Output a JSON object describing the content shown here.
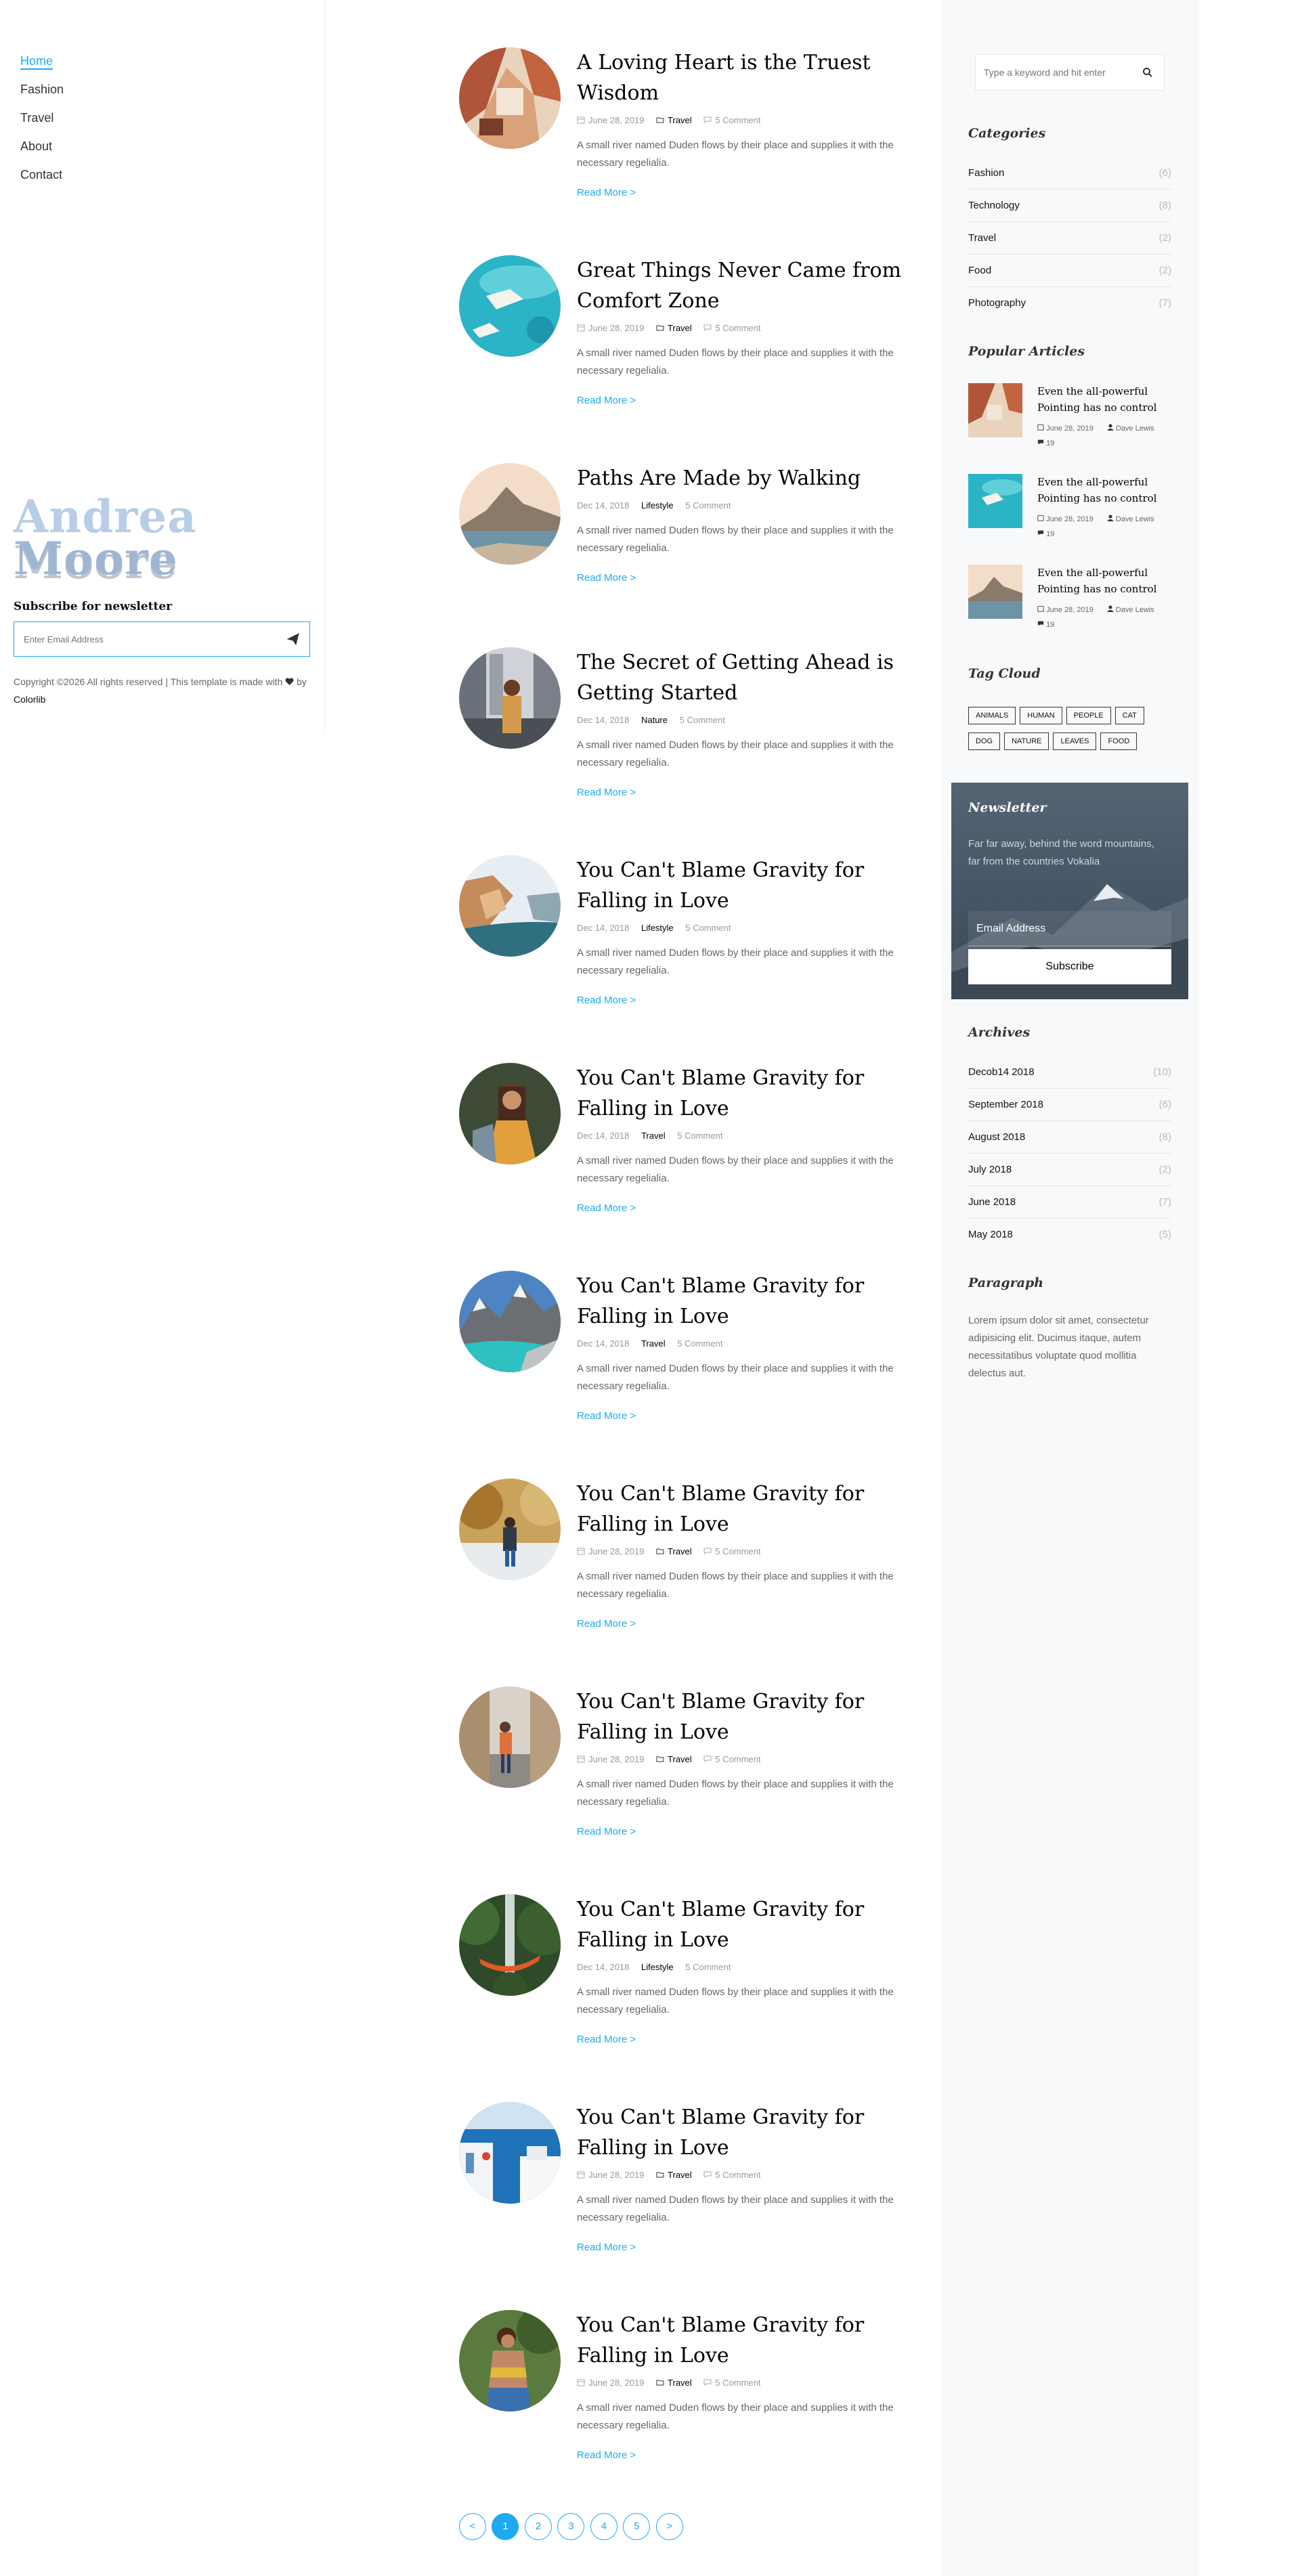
{
  "nav": {
    "items": [
      {
        "label": "Home",
        "active": true
      },
      {
        "label": "Fashion"
      },
      {
        "label": "Travel"
      },
      {
        "label": "About"
      },
      {
        "label": "Contact"
      }
    ]
  },
  "brand": {
    "line1": "Andrea",
    "line2": "Moore"
  },
  "left_newsletter": {
    "title": "Subscribe for newsletter",
    "placeholder": "Enter Email Address"
  },
  "copyright": {
    "text": "Copyright ©2026 All rights reserved | This template is made with",
    "by": "by",
    "link": "Colorlib"
  },
  "posts": [
    {
      "title": "A Loving Heart is the Truest Wisdom",
      "date": "June 28, 2019",
      "category": "Travel",
      "comments": "5 Comment",
      "excerpt": "A small river named Duden flows by their place and supplies it with the necessary regelialia.",
      "read_more": "Read More >"
    },
    {
      "title": "Great Things Never Came from Comfort Zone",
      "date": "June 28, 2019",
      "category": "Travel",
      "comments": "5 Comment",
      "excerpt": "A small river named Duden flows by their place and supplies it with the necessary regelialia.",
      "read_more": "Read More >"
    },
    {
      "title": "Paths Are Made by Walking",
      "date": "Dec 14, 2018",
      "category": "Lifestyle",
      "comments": "5 Comment",
      "excerpt": "A small river named Duden flows by their place and supplies it with the necessary regelialia.",
      "read_more": "Read More >"
    },
    {
      "title": "The Secret of Getting Ahead is Getting Started",
      "date": "Dec 14, 2018",
      "category": "Nature",
      "comments": "5 Comment",
      "excerpt": "A small river named Duden flows by their place and supplies it with the necessary regelialia.",
      "read_more": "Read More >"
    },
    {
      "title": "You Can't Blame Gravity for Falling in Love",
      "date": "Dec 14, 2018",
      "category": "Lifestyle",
      "comments": "5 Comment",
      "excerpt": "A small river named Duden flows by their place and supplies it with the necessary regelialia.",
      "read_more": "Read More >"
    },
    {
      "title": "You Can't Blame Gravity for Falling in Love",
      "date": "Dec 14, 2018",
      "category": "Travel",
      "comments": "5 Comment",
      "excerpt": "A small river named Duden flows by their place and supplies it with the necessary regelialia.",
      "read_more": "Read More >"
    },
    {
      "title": "You Can't Blame Gravity for Falling in Love",
      "date": "Dec 14, 2018",
      "category": "Travel",
      "comments": "5 Comment",
      "excerpt": "A small river named Duden flows by their place and supplies it with the necessary regelialia.",
      "read_more": "Read More >"
    },
    {
      "title": "You Can't Blame Gravity for Falling in Love",
      "date": "June 28, 2019",
      "category": "Travel",
      "comments": "5 Comment",
      "excerpt": "A small river named Duden flows by their place and supplies it with the necessary regelialia.",
      "read_more": "Read More >"
    },
    {
      "title": "You Can't Blame Gravity for Falling in Love",
      "date": "June 28, 2019",
      "category": "Travel",
      "comments": "5 Comment",
      "excerpt": "A small river named Duden flows by their place and supplies it with the necessary regelialia.",
      "read_more": "Read More >"
    },
    {
      "title": "You Can't Blame Gravity for Falling in Love",
      "date": "Dec 14, 2018",
      "category": "Lifestyle",
      "comments": "5 Comment",
      "excerpt": "A small river named Duden flows by their place and supplies it with the necessary regelialia.",
      "read_more": "Read More >"
    },
    {
      "title": "You Can't Blame Gravity for Falling in Love",
      "date": "June 28, 2019",
      "category": "Travel",
      "comments": "5 Comment",
      "excerpt": "A small river named Duden flows by their place and supplies it with the necessary regelialia.",
      "read_more": "Read More >"
    },
    {
      "title": "You Can't Blame Gravity for Falling in Love",
      "date": "June 28, 2019",
      "category": "Travel",
      "comments": "5 Comment",
      "excerpt": "A small river named Duden flows by their place and supplies it with the necessary regelialia.",
      "read_more": "Read More >"
    }
  ],
  "pagination": {
    "prev": "<",
    "pages": [
      "1",
      "2",
      "3",
      "4",
      "5"
    ],
    "next": ">",
    "active": "1"
  },
  "sidebar": {
    "search_placeholder": "Type a keyword and hit enter",
    "categories_heading": "Categories",
    "categories": [
      {
        "name": "Fashion",
        "count": "(6)"
      },
      {
        "name": "Technology",
        "count": "(8)"
      },
      {
        "name": "Travel",
        "count": "(2)"
      },
      {
        "name": "Food",
        "count": "(2)"
      },
      {
        "name": "Photography",
        "count": "(7)"
      }
    ],
    "popular_heading": "Popular Articles",
    "popular": [
      {
        "title": "Even the all-powerful Pointing has no control",
        "date": "June 28, 2019",
        "author": "Dave Lewis",
        "comments": "19"
      },
      {
        "title": "Even the all-powerful Pointing has no control",
        "date": "June 28, 2019",
        "author": "Dave Lewis",
        "comments": "19"
      },
      {
        "title": "Even the all-powerful Pointing has no control",
        "date": "June 28, 2019",
        "author": "Dave Lewis",
        "comments": "19"
      }
    ],
    "tag_heading": "Tag Cloud",
    "tags": [
      "ANIMALS",
      "HUMAN",
      "PEOPLE",
      "CAT",
      "DOG",
      "NATURE",
      "LEAVES",
      "FOOD"
    ],
    "newsletter": {
      "title": "Newsletter",
      "text": "Far far away, behind the word mountains, far from the countries Vokalia",
      "placeholder": "Email Address",
      "button": "Subscribe"
    },
    "archives_heading": "Archives",
    "archives": [
      {
        "name": "Decob14 2018",
        "count": "(10)"
      },
      {
        "name": "September 2018",
        "count": "(6)"
      },
      {
        "name": "August 2018",
        "count": "(8)"
      },
      {
        "name": "July 2018",
        "count": "(2)"
      },
      {
        "name": "June 2018",
        "count": "(7)"
      },
      {
        "name": "May 2018",
        "count": "(5)"
      }
    ],
    "paragraph_heading": "Paragraph",
    "paragraph": "Lorem ipsum dolor sit amet, consectetur adipisicing elit. Ducimus itaque, autem necessitatibus voluptate quod mollitia delectus aut."
  },
  "colors": {
    "accent": "#1eaaf1",
    "sidebar_bg": "#f8f9fa",
    "newsletter_bg": "#4a5869"
  },
  "icons": {
    "date": "calendar-icon",
    "category": "folder-icon",
    "comments": "chat-icon",
    "search": "search-icon",
    "send": "paper-plane-icon",
    "heart": "heart-icon",
    "author": "person-icon"
  }
}
